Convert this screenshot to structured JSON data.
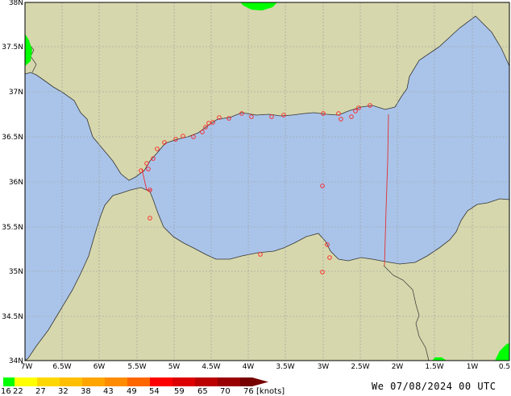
{
  "colors": {
    "land": "#d6d7ad",
    "sea": "#aac4e9",
    "grid": "#999999",
    "coast": "#333333",
    "station": "#ff2020",
    "border_red": "#e03030",
    "wind_green": "#00ff00"
  },
  "map": {
    "lat_labels": [
      "38N",
      "37.5N",
      "37N",
      "36.5N",
      "36N",
      "35.5N",
      "35N",
      "34.5N",
      "34N"
    ],
    "lon_labels": [
      "7W",
      "6.5W",
      "6W",
      "5.5W",
      "5W",
      "4.5W",
      "4W",
      "3.5W",
      "3W",
      "2.5W",
      "2W",
      "1.5W",
      "1W",
      "0.5"
    ]
  },
  "legend": {
    "values": [
      "16",
      "22",
      "27",
      "32",
      "38",
      "43",
      "49",
      "54",
      "59",
      "65",
      "70",
      "76"
    ],
    "unit": "[knots]",
    "colors": [
      "#00ff00",
      "#ffff00",
      "#ffd700",
      "#ffbf00",
      "#ffa500",
      "#ff8c00",
      "#ff6600",
      "#ff0000",
      "#dd0000",
      "#bb0000",
      "#990000",
      "#770000"
    ]
  },
  "timestamp": "We 07/08/2024 00 UTC"
}
